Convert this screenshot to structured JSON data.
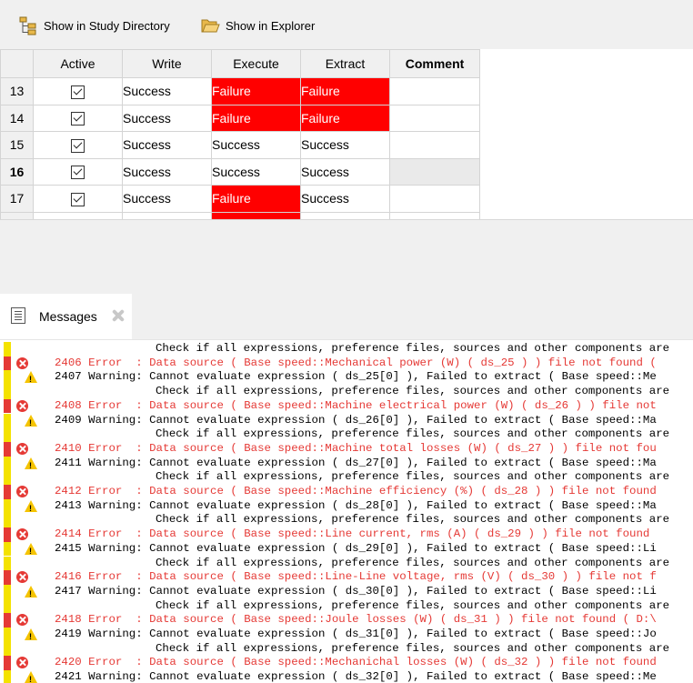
{
  "toolbar": {
    "study_dir_label": "Show in Study Directory",
    "explorer_label": "Show in Explorer"
  },
  "grid": {
    "columns": [
      "Active",
      "Write",
      "Execute",
      "Extract",
      "Comment"
    ],
    "rows": [
      {
        "num": "13",
        "active": true,
        "write": "Success",
        "execute": "Failure",
        "extract": "Failure",
        "comment": ""
      },
      {
        "num": "14",
        "active": true,
        "write": "Success",
        "execute": "Failure",
        "extract": "Failure",
        "comment": ""
      },
      {
        "num": "15",
        "active": true,
        "write": "Success",
        "execute": "Success",
        "extract": "Success",
        "comment": ""
      },
      {
        "num": "16",
        "active": true,
        "write": "Success",
        "execute": "Success",
        "extract": "Success",
        "comment": "",
        "current": true
      },
      {
        "num": "17",
        "active": true,
        "write": "Success",
        "execute": "Failure",
        "extract": "Success",
        "comment": ""
      }
    ],
    "colors": {
      "failure": "#ff0000"
    }
  },
  "messages": {
    "tab_title": "Messages",
    "lines": [
      {
        "kind": "cont",
        "text": "Check if all expressions, preference files, sources and other components are"
      },
      {
        "kind": "error",
        "text": "2406 Error  : Data source ( Base speed::Mechanical power (W) ( ds_25 ) ) file not found ("
      },
      {
        "kind": "warning",
        "text": "2407 Warning: Cannot evaluate expression ( ds_25[0] ), Failed to extract ( Base speed::Me"
      },
      {
        "kind": "cont",
        "text": "Check if all expressions, preference files, sources and other components are"
      },
      {
        "kind": "error",
        "text": "2408 Error  : Data source ( Base speed::Machine electrical power (W) ( ds_26 ) ) file not"
      },
      {
        "kind": "warning",
        "text": "2409 Warning: Cannot evaluate expression ( ds_26[0] ), Failed to extract ( Base speed::Ma"
      },
      {
        "kind": "cont",
        "text": "Check if all expressions, preference files, sources and other components are"
      },
      {
        "kind": "error",
        "text": "2410 Error  : Data source ( Base speed::Machine total losses (W) ( ds_27 ) ) file not fou"
      },
      {
        "kind": "warning",
        "text": "2411 Warning: Cannot evaluate expression ( ds_27[0] ), Failed to extract ( Base speed::Ma"
      },
      {
        "kind": "cont",
        "text": "Check if all expressions, preference files, sources and other components are"
      },
      {
        "kind": "error",
        "text": "2412 Error  : Data source ( Base speed::Machine efficiency (%) ( ds_28 ) ) file not found"
      },
      {
        "kind": "warning",
        "text": "2413 Warning: Cannot evaluate expression ( ds_28[0] ), Failed to extract ( Base speed::Ma"
      },
      {
        "kind": "cont",
        "text": "Check if all expressions, preference files, sources and other components are"
      },
      {
        "kind": "error",
        "text": "2414 Error  : Data source ( Base speed::Line current, rms (A) ( ds_29 ) ) file not found"
      },
      {
        "kind": "warning",
        "text": "2415 Warning: Cannot evaluate expression ( ds_29[0] ), Failed to extract ( Base speed::Li"
      },
      {
        "kind": "cont",
        "text": "Check if all expressions, preference files, sources and other components are"
      },
      {
        "kind": "error",
        "text": "2416 Error  : Data source ( Base speed::Line-Line voltage, rms (V) ( ds_30 ) ) file not f"
      },
      {
        "kind": "warning",
        "text": "2417 Warning: Cannot evaluate expression ( ds_30[0] ), Failed to extract ( Base speed::Li"
      },
      {
        "kind": "cont",
        "text": "Check if all expressions, preference files, sources and other components are"
      },
      {
        "kind": "error",
        "text": "2418 Error  : Data source ( Base speed::Joule losses (W) ( ds_31 ) ) file not found ( D:\\"
      },
      {
        "kind": "warning",
        "text": "2419 Warning: Cannot evaluate expression ( ds_31[0] ), Failed to extract ( Base speed::Jo"
      },
      {
        "kind": "cont",
        "text": "Check if all expressions, preference files, sources and other components are"
      },
      {
        "kind": "error",
        "text": "2420 Error  : Data source ( Base speed::Mechanichal losses (W) ( ds_32 ) ) file not found"
      },
      {
        "kind": "warning",
        "text": "2421 Warning: Cannot evaluate expression ( ds_32[0] ), Failed to extract ( Base speed::Me"
      }
    ]
  }
}
